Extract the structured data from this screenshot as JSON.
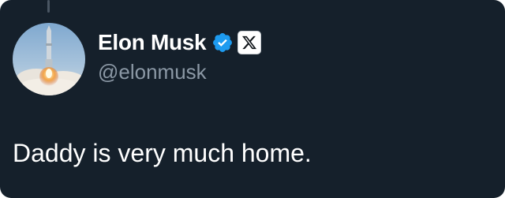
{
  "tweet": {
    "author": {
      "display_name": "Elon Musk",
      "handle": "@elonmusk",
      "verified": true,
      "verified_color": "#1d9bf0",
      "affiliate_badge_icon": "x-logo-icon",
      "avatar_icon": "rocket-launch-avatar"
    },
    "text": "Daddy is very much home."
  },
  "colors": {
    "background": "#15202b",
    "text": "#ffffff",
    "secondary_text": "#8b98a5",
    "accent": "#1d9bf0"
  }
}
